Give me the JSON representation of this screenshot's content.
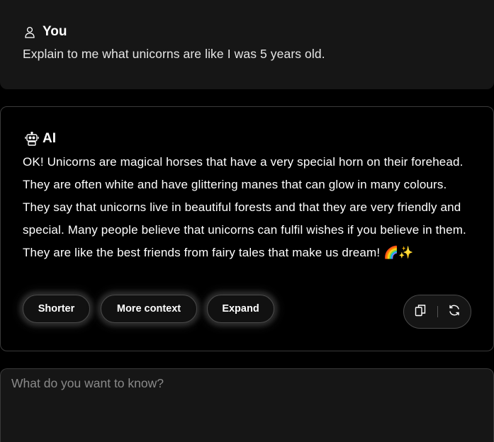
{
  "user_message": {
    "author": "You",
    "text": "Explain to me what unicorns are like I was 5 years old."
  },
  "ai_message": {
    "author": "AI",
    "text": "OK! Unicorns are magical horses that have a very special horn on their forehead. They are often white and have glittering manes that can glow in many colours. They say that unicorns live in beautiful forests and that they are very friendly and special. Many people believe that unicorns can fulfil wishes if you believe in them. They are like the best friends from fairy tales that make us dream! 🌈✨"
  },
  "suggestions": {
    "shorter": "Shorter",
    "more_context": "More context",
    "expand": "Expand"
  },
  "actions": {
    "copy_icon": "copy-icon",
    "regenerate_icon": "refresh-icon"
  },
  "composer": {
    "placeholder": "What do you want to know?",
    "value": ""
  }
}
